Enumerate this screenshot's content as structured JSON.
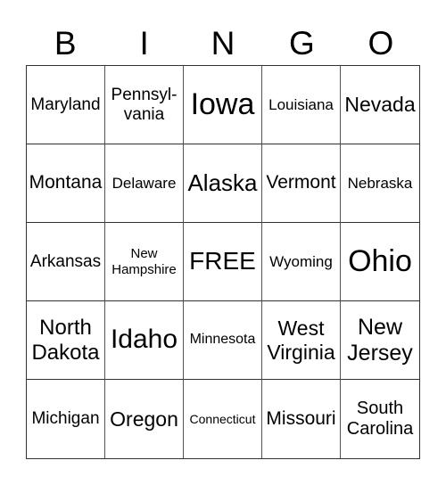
{
  "header": [
    "B",
    "I",
    "N",
    "G",
    "O"
  ],
  "cells": [
    {
      "text": "Maryland",
      "size": 19
    },
    {
      "text": "Pennsyl-\nvania",
      "size": 19
    },
    {
      "text": "Iowa",
      "size": 34
    },
    {
      "text": "Louisiana",
      "size": 17
    },
    {
      "text": "Nevada",
      "size": 23
    },
    {
      "text": "Montana",
      "size": 21
    },
    {
      "text": "Delaware",
      "size": 17
    },
    {
      "text": "Alaska",
      "size": 26
    },
    {
      "text": "Vermont",
      "size": 21
    },
    {
      "text": "Nebraska",
      "size": 17
    },
    {
      "text": "Arkansas",
      "size": 19
    },
    {
      "text": "New\nHampshire",
      "size": 15
    },
    {
      "text": "FREE",
      "size": 28
    },
    {
      "text": "Wyoming",
      "size": 17
    },
    {
      "text": "Ohio",
      "size": 34
    },
    {
      "text": "North\nDakota",
      "size": 24
    },
    {
      "text": "Idaho",
      "size": 30
    },
    {
      "text": "Minnesota",
      "size": 16
    },
    {
      "text": "West\nVirginia",
      "size": 23
    },
    {
      "text": "New\nJersey",
      "size": 25
    },
    {
      "text": "Michigan",
      "size": 19
    },
    {
      "text": "Oregon",
      "size": 23
    },
    {
      "text": "Connecticut",
      "size": 14
    },
    {
      "text": "Missouri",
      "size": 21
    },
    {
      "text": "South\nCarolina",
      "size": 20
    }
  ]
}
